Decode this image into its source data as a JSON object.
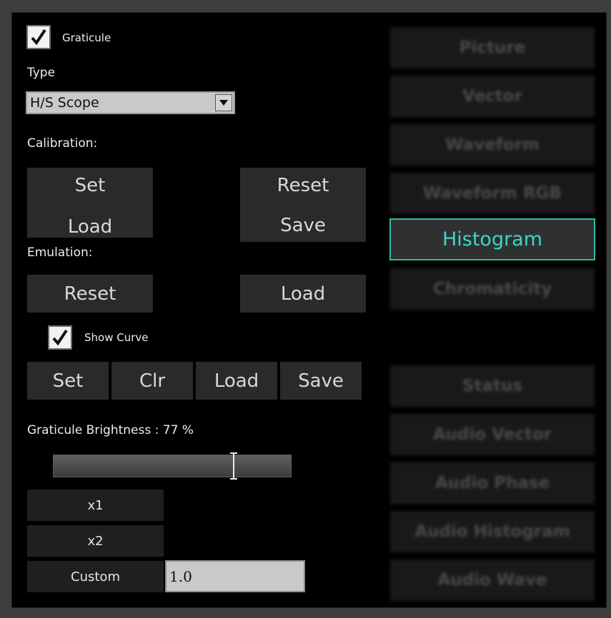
{
  "graticule": {
    "label": "Graticule",
    "checked": true
  },
  "type": {
    "label": "Type",
    "selected": "H/S Scope"
  },
  "calibration": {
    "label": "Calibration:",
    "set_load_top": "Set",
    "set_load_bottom": "Load",
    "reset_save_top": "Reset",
    "reset_save_bottom": "Save"
  },
  "emulation": {
    "label": "Emulation:",
    "reset": "Reset",
    "load": "Load"
  },
  "show_curve": {
    "label": "Show Curve",
    "checked": true
  },
  "curve_buttons": {
    "set": "Set",
    "clr": "Clr",
    "load": "Load",
    "save": "Save"
  },
  "brightness": {
    "label": "Graticule Brightness : 77 %",
    "value_percent": 77
  },
  "zoom": {
    "x1": "x1",
    "x2": "x2",
    "custom": "Custom",
    "custom_value": "1.0"
  },
  "sidebar": {
    "top": [
      "Picture",
      "Vector",
      "Waveform",
      "Waveform RGB",
      "Histogram",
      "Chromaticity"
    ],
    "bottom": [
      "Status",
      "Audio Vector",
      "Audio Phase",
      "Audio Histogram",
      "Audio Wave"
    ],
    "active": "Histogram"
  },
  "colors": {
    "accent": "#2fb8a8",
    "background": "#000000",
    "button": "#2a2a2a"
  }
}
